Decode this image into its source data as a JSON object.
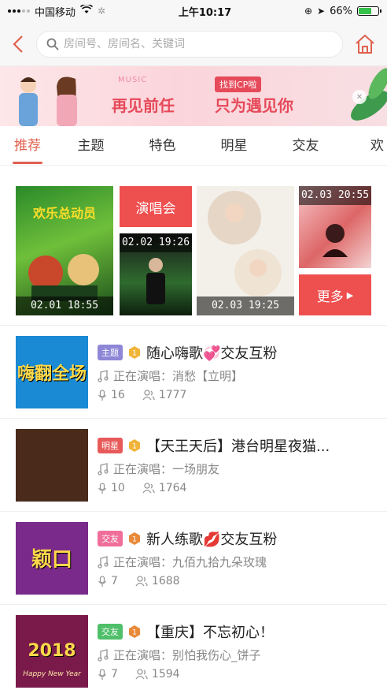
{
  "statusbar": {
    "carrier": "中国移动",
    "time": "上午10:17",
    "battery": "66%",
    "battery_level": 0.66
  },
  "search": {
    "placeholder": "房间号、房间名、关键词"
  },
  "banner": {
    "music_text": "MUSIC",
    "title_left": "再见前任",
    "tag": "找到CP啦",
    "title_right": "只为遇见你"
  },
  "tabs": [
    {
      "label": "推荐",
      "active": true
    },
    {
      "label": "主题"
    },
    {
      "label": "特色"
    },
    {
      "label": "明星"
    },
    {
      "label": "交友"
    },
    {
      "label": "欢"
    }
  ],
  "featured": {
    "item1_time": "02.01 18:55",
    "concert_label": "演唱会",
    "item2_time": "02.02 19:26",
    "item3_time": "02.03 19:25",
    "item4_time": "02.03 20:55",
    "more_label": "更多"
  },
  "rooms": [
    {
      "badge": "主题",
      "badge_color": "#8e86d6",
      "level_color": "#f0b43a",
      "title": "随心嗨歌💞交友互粉",
      "singing_label": "正在演唱：",
      "song": "消愁【立明】",
      "seats": "16",
      "listeners": "1777",
      "thumb_text": "嗨翻全场",
      "thumb_bg": "#1a8ad4"
    },
    {
      "badge": "明星",
      "badge_color": "#e85a5a",
      "level_color": "#f0b43a",
      "title": "【天王天后】港台明星夜猫...",
      "singing_label": "正在演唱：",
      "song": "一场朋友",
      "seats": "10",
      "listeners": "1764",
      "thumb_text": "",
      "thumb_bg": "#4a2a1a"
    },
    {
      "badge": "交友",
      "badge_color": "#ef6e9a",
      "level_color": "#e98a3a",
      "title": "新人练歌💋交友互粉",
      "singing_label": "正在演唱：",
      "song": "九佰九拾九朵玫瑰",
      "seats": "7",
      "listeners": "1688",
      "thumb_text": "颖口",
      "thumb_bg": "#7a2a8a"
    },
    {
      "badge": "交友",
      "badge_color": "#4fbf6a",
      "level_color": "#e98a3a",
      "title": "【重庆】不忘初心！",
      "singing_label": "正在演唱：",
      "song": "别怕我伤心_饼子",
      "seats": "7",
      "listeners": "1594",
      "thumb_text": "2018",
      "thumb_sub": "Happy New Year",
      "thumb_bg": "#7a1a4a"
    }
  ]
}
